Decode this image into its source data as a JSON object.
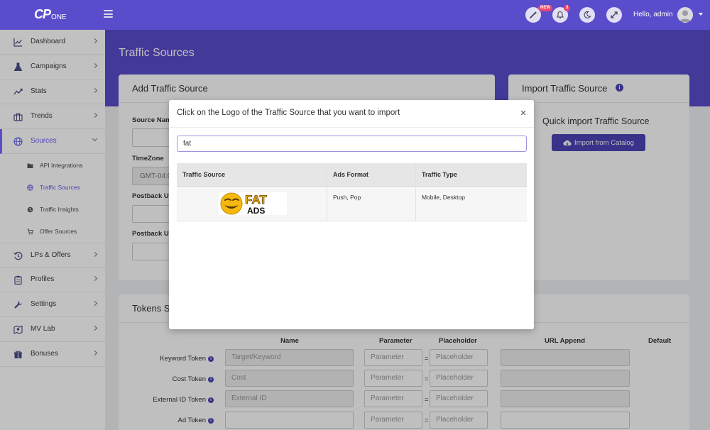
{
  "navbar": {
    "logo_text": "CP",
    "logo_sub": "ONE",
    "new_badge": "NEW",
    "notification_count": "3",
    "greeting": "Hello, admin"
  },
  "sidebar": {
    "items": [
      {
        "label": "Dashboard",
        "icon": "chart-line-icon"
      },
      {
        "label": "Campaigns",
        "icon": "flask-icon"
      },
      {
        "label": "Stats",
        "icon": "chart-trend-icon"
      },
      {
        "label": "Trends",
        "icon": "briefcase-icon"
      },
      {
        "label": "Sources",
        "icon": "globe-icon"
      },
      {
        "label": "LPs & Offers",
        "icon": "history-icon"
      },
      {
        "label": "Profiles",
        "icon": "clipboard-icon"
      },
      {
        "label": "Settings",
        "icon": "wrench-icon"
      },
      {
        "label": "MV Lab",
        "icon": "map-marker-icon"
      },
      {
        "label": "Bonuses",
        "icon": "gift-icon"
      }
    ],
    "sources_sub": [
      {
        "label": "API Integrations",
        "icon": "folder-icon"
      },
      {
        "label": "Traffic Sources",
        "icon": "globe-icon"
      },
      {
        "label": "Traffic Insights",
        "icon": "globe-solid-icon"
      },
      {
        "label": "Offer Sources",
        "icon": "cart-icon"
      }
    ]
  },
  "page": {
    "title": "Traffic Sources"
  },
  "add_card": {
    "title": "Add Traffic Source",
    "source_name_label": "Source Name",
    "timezone_label": "TimeZone",
    "timezone_value": "GMT-04:00",
    "postback_url_label": "Postback URL",
    "postback_url_label_2": "Postback URL"
  },
  "import_card": {
    "title": "Import Traffic Source",
    "subtitle": "Quick import Traffic Source",
    "button": "Import from Catalog"
  },
  "tokens_card": {
    "title": "Tokens Settings",
    "headers": {
      "name": "Name",
      "parameter": "Parameter",
      "placeholder": "Placeholder",
      "url_append": "URL Append",
      "default": "Default"
    },
    "rows": [
      {
        "label": "Keyword Token",
        "name_placeholder": "Target/Keyword",
        "param_placeholder": "Parameter",
        "placeholder_placeholder": "Placeholder"
      },
      {
        "label": "Cost Token",
        "name_placeholder": "Cost",
        "param_placeholder": "Parameter",
        "placeholder_placeholder": "Placeholder"
      },
      {
        "label": "External ID Token",
        "name_placeholder": "External ID",
        "param_placeholder": "Parameter",
        "placeholder_placeholder": "Placeholder"
      },
      {
        "label": "Ad Token",
        "name_placeholder": "",
        "param_placeholder": "Parameter",
        "placeholder_placeholder": "Placeholder"
      }
    ],
    "eq": "="
  },
  "modal": {
    "title": "Click on the Logo of the Traffic Source that you want to import",
    "close": "×",
    "search_value": "fat",
    "columns": [
      "Traffic Source",
      "Ads Format",
      "Traffic Type"
    ],
    "rows": [
      {
        "logo_top": "FAT",
        "logo_bottom": "ADS",
        "ads_format": "Push, Pop",
        "traffic_type": "Mobile, Desktop"
      }
    ]
  },
  "colors": {
    "brand": "#5a4dcc",
    "button": "#4b43b8",
    "logo_yellow": "#f5b80f"
  }
}
